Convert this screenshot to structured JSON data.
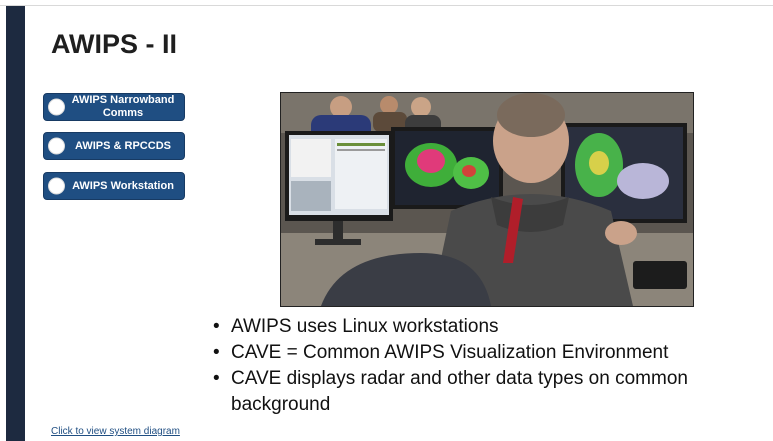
{
  "slide": {
    "title": "AWIPS - II",
    "nav_buttons": [
      {
        "label": "AWIPS Narrowband Comms"
      },
      {
        "label": "AWIPS & RPCCDS"
      },
      {
        "label": "AWIPS Workstation"
      }
    ],
    "photo": {
      "icon": "awips-workstation-photo"
    },
    "bullets": [
      {
        "text": "AWIPS uses Linux workstations"
      },
      {
        "text": "CAVE = Common AWIPS Visualization Environment"
      },
      {
        "text": "CAVE displays radar and other data types on common background"
      }
    ],
    "bullet_glyph": "•",
    "footer_link": "Click to view system diagram"
  },
  "colors": {
    "sidebar": "#1d2a40",
    "button_fill": "#1f4e82",
    "link": "#1f4e82"
  }
}
